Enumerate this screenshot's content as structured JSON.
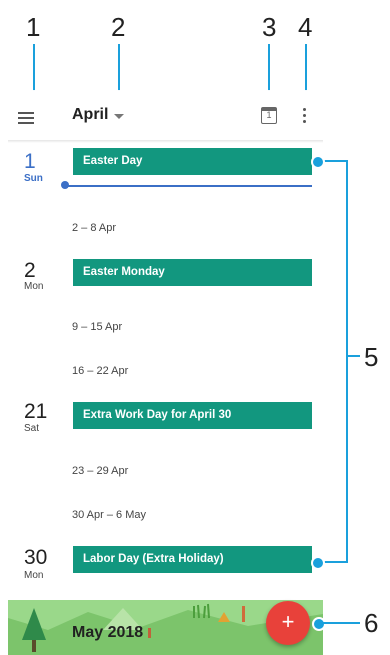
{
  "callouts": [
    "1",
    "2",
    "3",
    "4",
    "5",
    "6"
  ],
  "toolbar": {
    "menu_icon": "hamburger-menu-icon",
    "month_label": "April",
    "today_icon": "calendar-today-icon",
    "today_icon_number": "1",
    "more_icon": "more-vert-icon"
  },
  "days": [
    {
      "num": "1",
      "weekday": "Sun",
      "event": "Easter Day"
    },
    {
      "num": "2",
      "weekday": "Mon",
      "event": "Easter Monday"
    },
    {
      "num": "21",
      "weekday": "Sat",
      "event": "Extra Work Day for April 30"
    },
    {
      "num": "30",
      "weekday": "Mon",
      "event": "Labor Day (Extra Holiday)"
    }
  ],
  "weeks": [
    "2 – 8 Apr",
    "9 – 15 Apr",
    "16 – 22 Apr",
    "23 – 29 Apr",
    "30 Apr – 6 May"
  ],
  "banner": {
    "month_label": "May 2018"
  },
  "fab": {
    "label": "+",
    "icon": "add-icon"
  },
  "colors": {
    "event": "#12977f",
    "today": "#3b6fc6",
    "fab": "#e8413a",
    "callout": "#1aa0dc",
    "banner": "#8fd07d"
  }
}
